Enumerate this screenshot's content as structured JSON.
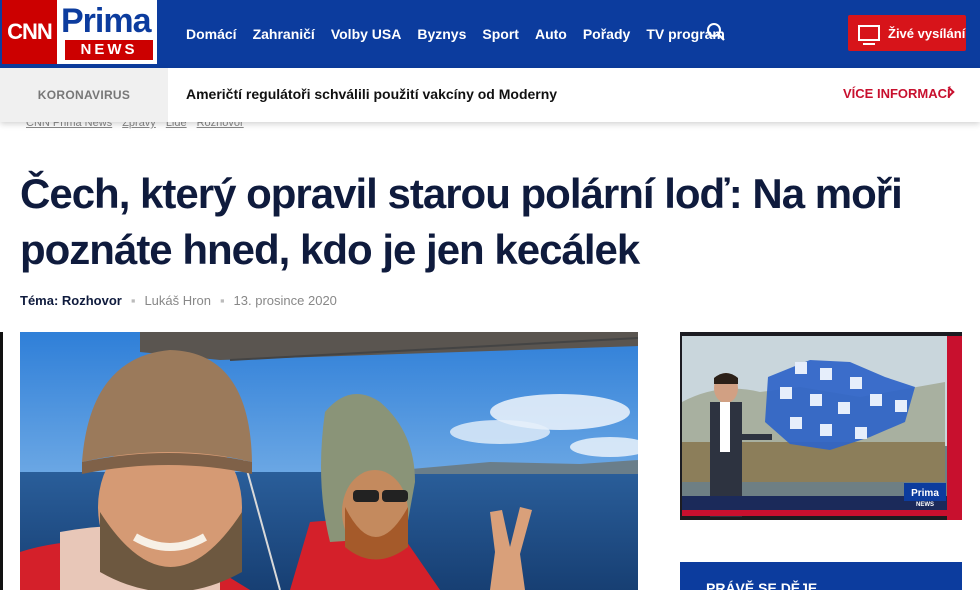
{
  "header": {
    "logo_cnn": "CNN",
    "logo_prima": "Prima",
    "logo_news": "NEWS",
    "nav": [
      "Domácí",
      "Zahraničí",
      "Volby USA",
      "Byznys",
      "Sport",
      "Auto",
      "Pořady",
      "TV program"
    ],
    "live_label": "Živé vysílání",
    "colors": {
      "bar": "#0c3c9e",
      "accent": "#d7141a"
    }
  },
  "breaking": {
    "tag": "KORONAVIRUS",
    "headline": "Američtí regulátoři schválili použití vakcíny od Moderny",
    "more": "VÍCE INFORMACÍ"
  },
  "breadcrumb": [
    "CNN Prima News",
    "Zprávy",
    "Lidé",
    "Rozhovor"
  ],
  "article": {
    "title": "Čech, který opravil starou polární loď: Na moři poznáte hned, kdo je jen kecálek",
    "topic": "Téma: Rozhovor",
    "author": "Lukáš Hron",
    "date": "13. prosince 2020"
  },
  "video": {
    "logo_prima": "Prima",
    "logo_news": "NEWS"
  },
  "sidebar": {
    "box_title": "PRÁVĚ SE DĚJE"
  }
}
